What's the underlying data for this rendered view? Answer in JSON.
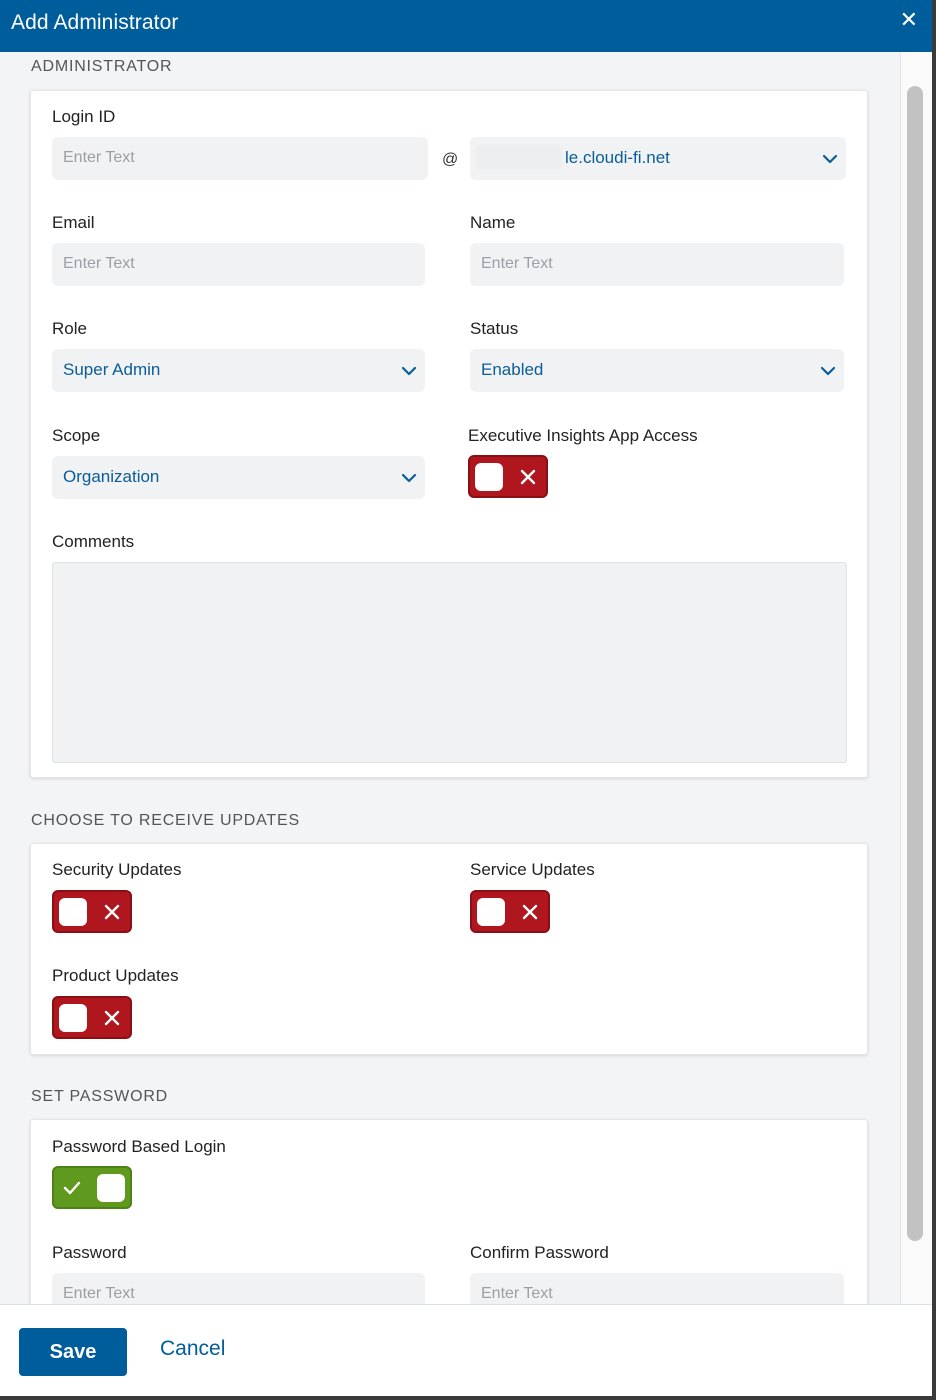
{
  "dialog": {
    "title": "Add Administrator",
    "close_glyph": "✕"
  },
  "sections": {
    "administrator": "ADMINISTRATOR",
    "updates": "CHOOSE TO RECEIVE UPDATES",
    "password": "SET PASSWORD"
  },
  "fields": {
    "login_id": {
      "label": "Login ID",
      "placeholder": "Enter Text"
    },
    "at_sign": "@",
    "domain": {
      "value": "le.cloudi-fi.net"
    },
    "email": {
      "label": "Email",
      "placeholder": "Enter Text"
    },
    "name": {
      "label": "Name",
      "placeholder": "Enter Text"
    },
    "role": {
      "label": "Role",
      "value": "Super Admin"
    },
    "status": {
      "label": "Status",
      "value": "Enabled"
    },
    "scope": {
      "label": "Scope",
      "value": "Organization"
    },
    "exec_insights": {
      "label": "Executive Insights App Access",
      "state": "off"
    },
    "comments": {
      "label": "Comments",
      "value": ""
    },
    "security_updates": {
      "label": "Security Updates",
      "state": "off"
    },
    "service_updates": {
      "label": "Service Updates",
      "state": "off"
    },
    "product_updates": {
      "label": "Product Updates",
      "state": "off"
    },
    "password_login": {
      "label": "Password Based Login",
      "state": "on"
    },
    "password": {
      "label": "Password",
      "placeholder": "Enter Text"
    },
    "confirm_password": {
      "label": "Confirm Password",
      "placeholder": "Enter Text"
    }
  },
  "footer": {
    "save_label": "Save",
    "cancel_label": "Cancel"
  },
  "colors": {
    "brand": "#005d9c",
    "toggle_off": "#b0161d",
    "toggle_on": "#5f9a1e"
  },
  "icons": {
    "chevron": "chevron-down-icon",
    "toggle_off_mark": "x-icon",
    "toggle_on_mark": "check-icon"
  }
}
